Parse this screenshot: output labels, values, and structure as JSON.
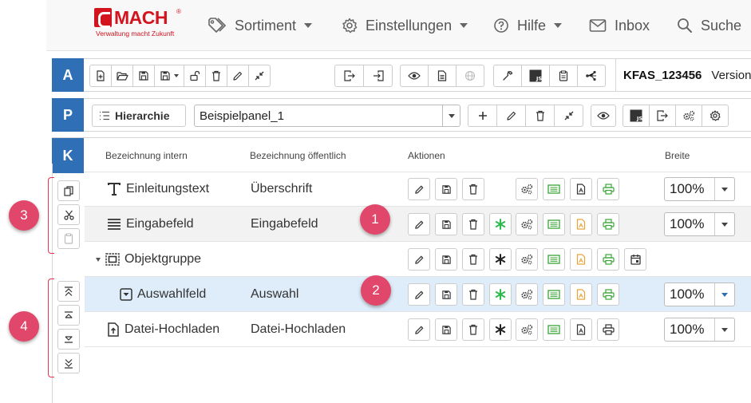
{
  "nav": {
    "logo_text": "MACH",
    "logo_reg": "®",
    "logo_tagline": "Verwaltung macht Zukunft",
    "items": [
      {
        "label": "Sortiment",
        "icon": "tag-icon",
        "dropdown": true
      },
      {
        "label": "Einstellungen",
        "icon": "gear-icon",
        "dropdown": true
      },
      {
        "label": "Hilfe",
        "icon": "question-circle-icon",
        "dropdown": true
      },
      {
        "label": "Inbox",
        "icon": "envelope-icon",
        "dropdown": false
      },
      {
        "label": "Suche",
        "icon": "search-icon",
        "dropdown": false
      }
    ]
  },
  "bar_a": {
    "letter": "A",
    "form_id": "KFAS_123456",
    "version_text": "Version"
  },
  "bar_p": {
    "letter": "P",
    "hierarchy_label": "Hierarchie",
    "panel_select_value": "Beispielpanel_1"
  },
  "bar_k": {
    "letter": "K",
    "columns": {
      "intern": "Bezeichnung intern",
      "public": "Bezeichnung öffentlich",
      "actions": "Aktionen",
      "width": "Breite"
    }
  },
  "rows": [
    {
      "name": "Einleitungstext",
      "public": "Überschrift",
      "icon": "text-type-icon",
      "width": "100%",
      "highlight": "none",
      "indent": 0
    },
    {
      "name": "Eingabefeld",
      "public": "Eingabefeld",
      "icon": "lines-icon",
      "width": "100%",
      "highlight": "grey",
      "indent": 0
    },
    {
      "name": "Objektgruppe",
      "public": "",
      "icon": "group-icon",
      "width": "",
      "highlight": "none",
      "indent": 0
    },
    {
      "name": "Auswahlfeld",
      "public": "Auswahl",
      "icon": "dropdown-box-icon",
      "width": "100%",
      "highlight": "blue",
      "indent": 1
    },
    {
      "name": "Datei-Hochladen",
      "public": "Datei-Hochladen",
      "icon": "file-upload-icon",
      "width": "100%",
      "highlight": "none",
      "indent": 0
    }
  ],
  "badges": [
    "1",
    "2",
    "3",
    "4"
  ],
  "colors": {
    "brand_red": "#d3131d",
    "bar_blue": "#2e6fb5",
    "badge_pink": "#e1476a",
    "green_star": "#2dbb4e",
    "green_icon": "#3aa535",
    "orange_pdf": "#e8a33a",
    "row_blue": "#dfecf9",
    "row_grey": "#f2f2f2"
  }
}
